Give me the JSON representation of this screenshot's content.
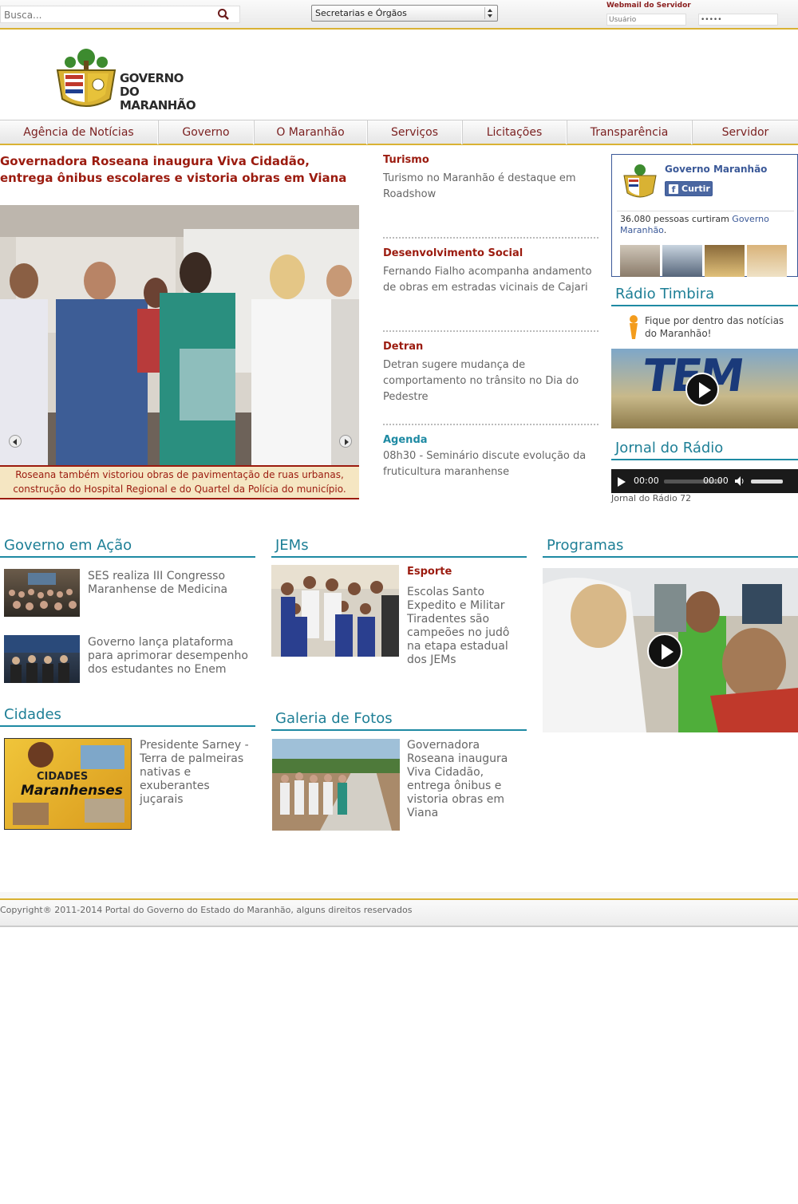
{
  "topbar": {
    "search_placeholder": "Busca...",
    "select_value": "Secretarias e Órgãos",
    "webmail_label": "Webmail do Servidor",
    "user_placeholder": "Usuário",
    "password_value": "•••••"
  },
  "logo": {
    "line1": "GOVERNO",
    "line2": "DO MARANHÃO"
  },
  "nav": [
    "Agência de Notícias",
    "Governo",
    "O Maranhão",
    "Serviços",
    "Licitações",
    "Transparência",
    "Servidor"
  ],
  "main": {
    "headline": "Governadora Roseana inaugura Viva Cidadão, entrega ônibus escolares e vistoria obras em Viana",
    "caption": "Roseana também vistoriou obras de pavimentação de ruas urbanas, construção do Hospital Regional e do Quartel da Polícia do município."
  },
  "news": [
    {
      "category": "Turismo",
      "text": "Turismo no Maranhão é destaque em Roadshow"
    },
    {
      "category": "Desenvolvimento Social",
      "text": "Fernando Fialho acompanha andamento de obras em estradas vicinais de Cajari"
    },
    {
      "category": "Detran",
      "text": "Detran sugere mudança de comportamento no trânsito no Dia do Pedestre"
    },
    {
      "category": "Agenda",
      "text": "08h30 - Seminário discute evolução da fruticultura maranhense"
    }
  ],
  "facebook": {
    "page_name": "Governo Maranhão",
    "like_label": "Curtir",
    "count_text": "36.080 pessoas curtiram",
    "count_link": "Governo Maranhão",
    "count_end": "."
  },
  "radio": {
    "title": "Rádio Timbira",
    "text": "Fique por dentro das notícias do Maranhão!",
    "video_text": "TEM"
  },
  "jornal": {
    "title": "Jornal do Rádio",
    "time_current": "00:00",
    "time_total": "00:00",
    "caption": "Jornal do Rádio 72"
  },
  "governo_acao": {
    "title": "Governo em Ação",
    "items": [
      "SES realiza III Congresso Maranhense de Medicina",
      "Governo lança plataforma para aprimorar desempenho dos estudantes no Enem"
    ]
  },
  "jems": {
    "title": "JEMs",
    "category": "Esporte",
    "text": "Escolas Santo Expedito e Militar Tiradentes são campeões no judô na etapa estadual dos JEMs"
  },
  "programas": {
    "title": "Programas"
  },
  "cidades": {
    "title": "Cidades",
    "text": "Presidente Sarney - Terra de palmeiras nativas e exuberantes juçarais",
    "thumb_line1": "CIDADES",
    "thumb_line2": "Maranhenses"
  },
  "galeria": {
    "title": "Galeria de Fotos",
    "text": "Governadora Roseana inaugura Viva Cidadão, entrega ônibus e vistoria obras em Viana"
  },
  "footer": {
    "text": "Copyright® 2011-2014 Portal do Governo do Estado do Maranhão, alguns direitos reservados"
  },
  "colors": {
    "accent_gold": "#d9b233",
    "headline_red": "#9b1b0f",
    "section_teal": "#1e8aa3",
    "facebook_blue": "#3b5998"
  }
}
